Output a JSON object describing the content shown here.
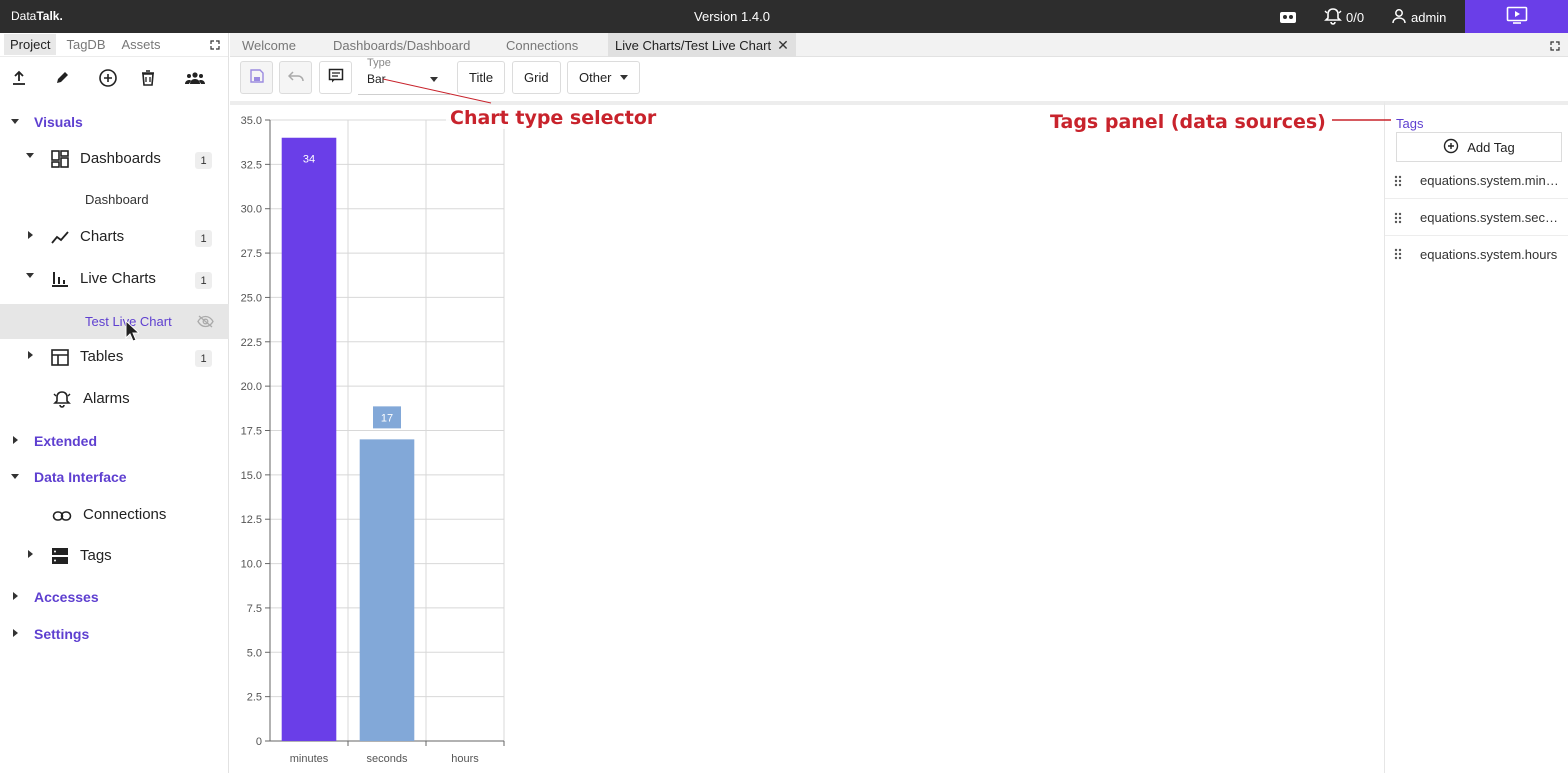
{
  "topbar": {
    "brand_a": "Data",
    "brand_b": "Talk.",
    "version": "Version 1.4.0",
    "alarm_count": "0/0",
    "user": "admin"
  },
  "sidebar": {
    "tabs": [
      "Project",
      "TagDB",
      "Assets"
    ],
    "sections": {
      "visuals": "Visuals",
      "extended": "Extended",
      "data_interface": "Data Interface",
      "accesses": "Accesses",
      "settings": "Settings"
    },
    "nodes": {
      "dashboards": "Dashboards",
      "dashboards_count": "1",
      "dashboard_leaf": "Dashboard",
      "charts": "Charts",
      "charts_count": "1",
      "live_charts": "Live Charts",
      "live_charts_count": "1",
      "test_live_chart": "Test Live Chart",
      "tables": "Tables",
      "tables_count": "1",
      "alarms": "Alarms",
      "connections": "Connections",
      "tags": "Tags"
    }
  },
  "tabs": [
    "Welcome",
    "Dashboards/Dashboard",
    "Connections",
    "Live Charts/Test Live Chart"
  ],
  "toolbar": {
    "type_label": "Type",
    "type_value": "Bar",
    "title_btn": "Title",
    "grid_btn": "Grid",
    "other_btn": "Other"
  },
  "tags_panel": {
    "title": "Tags",
    "add_tag": "Add Tag",
    "items": [
      "equations.system.minutes",
      "equations.system.seconds",
      "equations.system.hours"
    ]
  },
  "annotations": {
    "chart_type": "Chart type selector",
    "tags_panel": "Tags panel (data sources)"
  },
  "colors": {
    "accent": "#5e3fd0",
    "bar_primary": "#6a3ee8",
    "bar_secondary": "#82a8d8",
    "annotation": "#c8232c"
  },
  "chart_data": {
    "type": "bar",
    "categories": [
      "minutes",
      "seconds",
      "hours"
    ],
    "values": [
      34,
      17,
      null
    ],
    "ylim": [
      0,
      35
    ],
    "yticks": [
      "0",
      "2.5",
      "5.0",
      "7.5",
      "10.0",
      "12.5",
      "15.0",
      "17.5",
      "20.0",
      "22.5",
      "25.0",
      "27.5",
      "30.0",
      "32.5",
      "35.0"
    ],
    "data_labels": [
      "34",
      "17"
    ],
    "grid": true
  }
}
